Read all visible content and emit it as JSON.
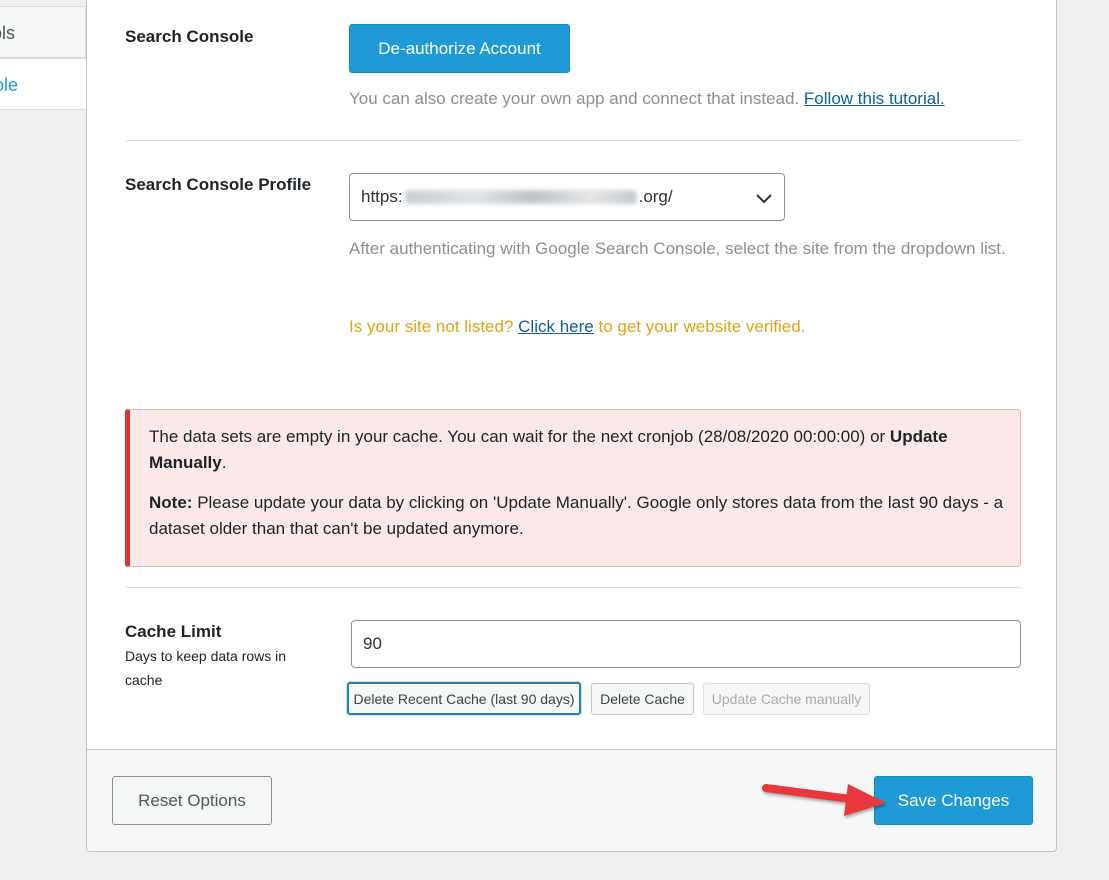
{
  "sidebar": {
    "tabs": [
      {
        "label": "ools"
      },
      {
        "label": "ole"
      }
    ]
  },
  "search_console": {
    "label": "Search Console",
    "deauthorize_label": "De-authorize Account",
    "help_text": "You can also create your own app and connect that instead.",
    "help_link": "Follow this tutorial."
  },
  "profile": {
    "label": "Search Console Profile",
    "selected_prefix": "https:",
    "selected_suffix": ".org/",
    "desc": "After authenticating with Google Search Console, select the site from the dropdown list.",
    "not_listed_prefix": "Is your site not listed?",
    "not_listed_link": "Click here",
    "not_listed_suffix": "to get your website verified."
  },
  "notice": {
    "line1_text": "The data sets are empty in your cache. You can wait for the next cronjob (28/08/2020 00:00:00) or",
    "line1_bold": "Update Manually",
    "line1_end": ".",
    "note_bold": "Note:",
    "note_text": "Please update your data by clicking on 'Update Manually'. Google only stores data from the last 90 days - a dataset older than that can't be updated anymore."
  },
  "cache": {
    "label": "Cache Limit",
    "sublabel": "Days to keep data rows in cache",
    "value": "90",
    "btn_delete_recent": "Delete Recent Cache (last 90 days)",
    "btn_delete": "Delete Cache",
    "btn_update": "Update Cache manually"
  },
  "footer": {
    "reset_label": "Reset Options",
    "save_label": "Save Changes"
  },
  "colors": {
    "primary": "#1e9ad6",
    "error_border": "#d63638",
    "notice_bg": "#fbe9e9",
    "warning_text": "#dba617",
    "arrow": "#e8373b"
  }
}
